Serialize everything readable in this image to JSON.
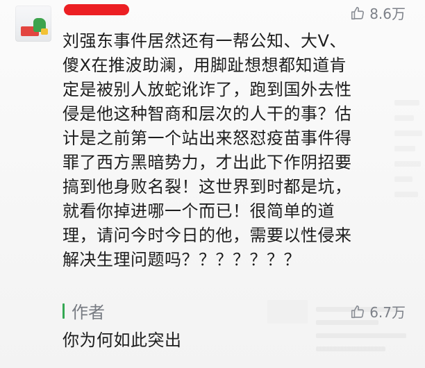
{
  "comment": {
    "likes": "8.6万",
    "lines": [
      "刘强东事件居然还有一帮公知、大V、",
      "傻X在推波助澜，用脚趾想想都知道肯",
      "定是被别人放蛇讹诈了，跑到国外去性",
      "侵是他这种智商和层次的人干的事？估",
      "计是之前第一个站出来怒怼疫苗事件得",
      "罪了西方黑暗势力，才出此下作阴招要",
      "搞到他身败名裂！这世界到时都是坑，",
      "就看你掉进哪一个而已！很简单的道",
      "理，请问今时今日的他，需要以性侵来",
      "解决生理问题吗？？？？？？？"
    ]
  },
  "reply": {
    "author": "作者",
    "text": "你为何如此突出",
    "likes": "6.7万"
  },
  "colors": {
    "accent_green": "#34a853",
    "redaction": "#ec1f23",
    "meta_gray": "#7c8088"
  },
  "icons": {
    "like": "thumbs-up-icon"
  }
}
